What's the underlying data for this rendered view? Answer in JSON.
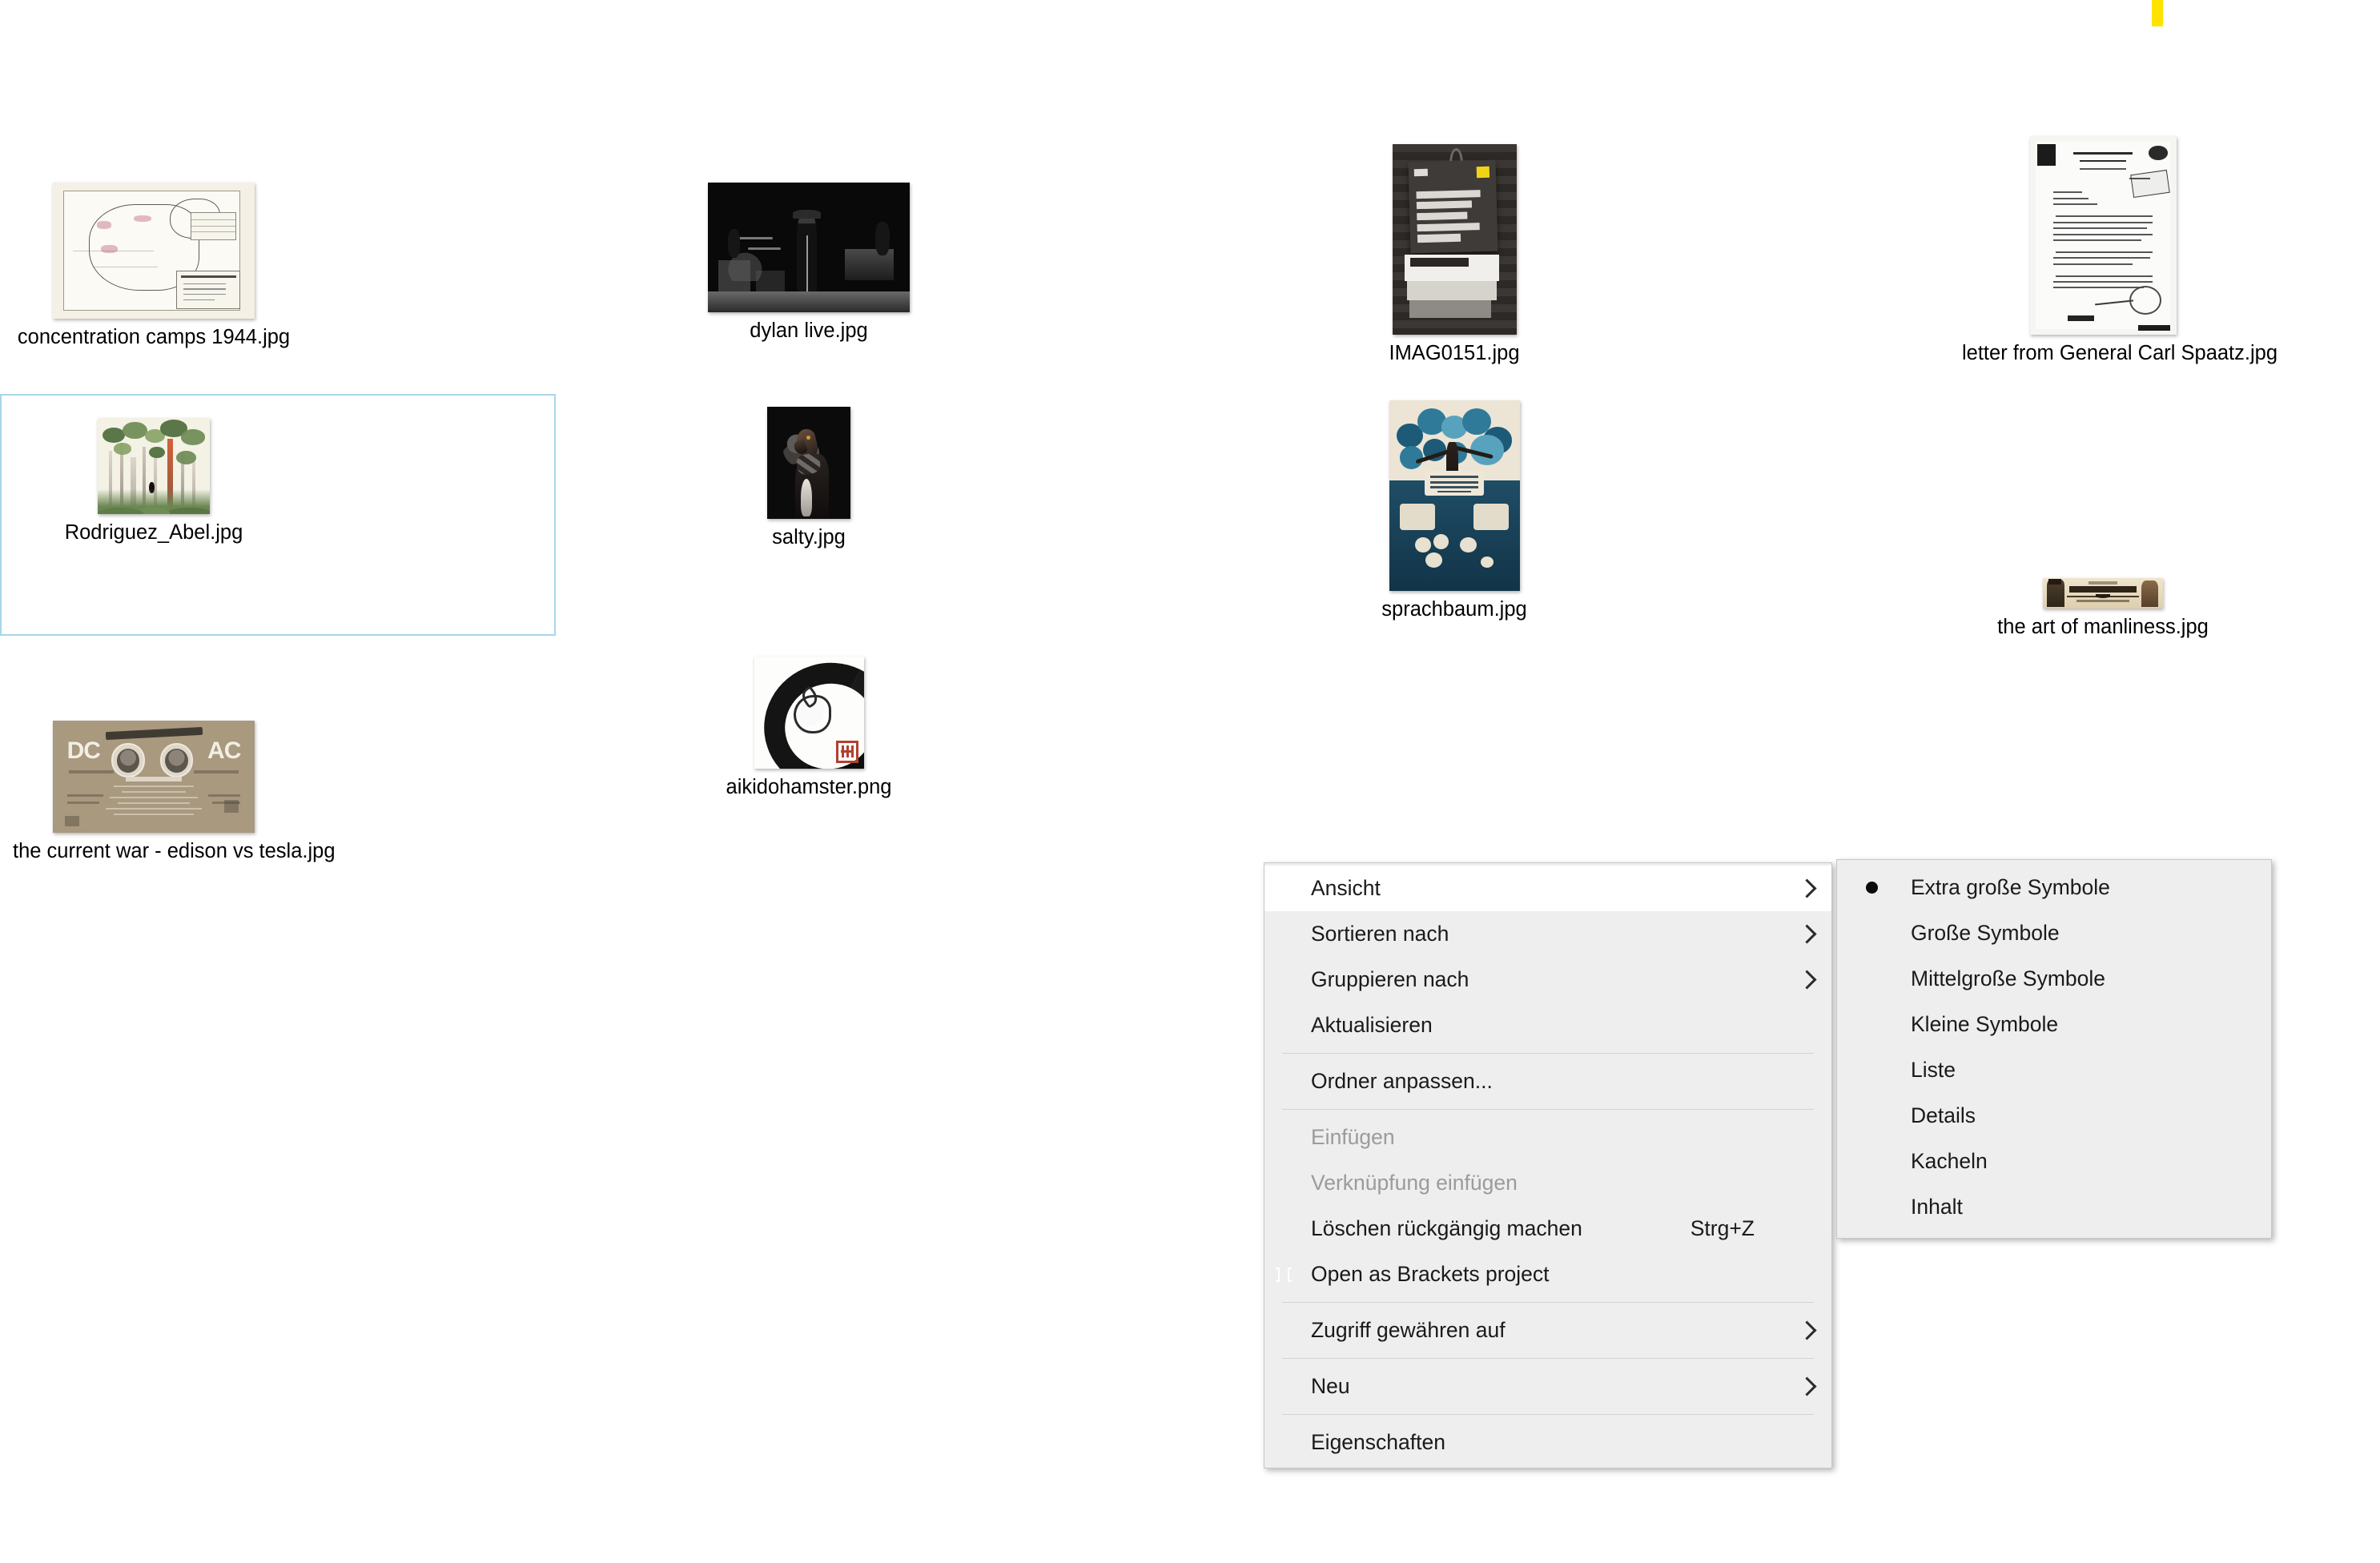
{
  "desktop": {
    "files": [
      {
        "name": "concentration camps 1944.jpg",
        "thumb": "map-thumbnail",
        "selected": false
      },
      {
        "name": "dylan live.jpg",
        "thumb": "concert-photo-thumbnail",
        "selected": false
      },
      {
        "name": "IMAG0151.jpg",
        "thumb": "clothing-hangtag-photo-thumbnail",
        "selected": false
      },
      {
        "name": "letter from General Carl Spaatz.jpg",
        "thumb": "scanned-letter-thumbnail",
        "selected": false
      },
      {
        "name": "Rodriguez_Abel.jpg",
        "thumb": "forest-painting-thumbnail",
        "selected": true
      },
      {
        "name": "salty.jpg",
        "thumb": "dog-portrait-thumbnail",
        "selected": false
      },
      {
        "name": "sprachbaum.jpg",
        "thumb": "language-tree-infographic-thumbnail",
        "selected": false
      },
      {
        "name": "the art of manliness.jpg",
        "thumb": "manliness-banner-thumbnail",
        "selected": false
      },
      {
        "name": "the current war - edison vs tesla.jpg",
        "thumb": "current-war-infographic-thumbnail",
        "selected": false
      },
      {
        "name": "aikidohamster.png",
        "thumb": "enso-hamster-thumbnail",
        "selected": false
      }
    ]
  },
  "context_menu": {
    "items": [
      {
        "label": "Ansicht",
        "submenu": true,
        "accel": "",
        "disabled": false,
        "hovered": true,
        "icon": ""
      },
      {
        "label": "Sortieren nach",
        "submenu": true,
        "accel": "",
        "disabled": false,
        "hovered": false,
        "icon": ""
      },
      {
        "label": "Gruppieren nach",
        "submenu": true,
        "accel": "",
        "disabled": false,
        "hovered": false,
        "icon": ""
      },
      {
        "label": "Aktualisieren",
        "submenu": false,
        "accel": "",
        "disabled": false,
        "hovered": false,
        "icon": ""
      },
      {
        "label": "Ordner anpassen...",
        "submenu": false,
        "accel": "",
        "disabled": false,
        "hovered": false,
        "icon": ""
      },
      {
        "label": "Einfügen",
        "submenu": false,
        "accel": "",
        "disabled": true,
        "hovered": false,
        "icon": ""
      },
      {
        "label": "Verknüpfung einfügen",
        "submenu": false,
        "accel": "",
        "disabled": true,
        "hovered": false,
        "icon": ""
      },
      {
        "label": "Löschen rückgängig machen",
        "submenu": false,
        "accel": "Strg+Z",
        "disabled": false,
        "hovered": false,
        "icon": ""
      },
      {
        "label": "Open as Brackets project",
        "submenu": false,
        "accel": "",
        "disabled": false,
        "hovered": false,
        "icon": "brackets-icon"
      },
      {
        "label": "Zugriff gewähren auf",
        "submenu": true,
        "accel": "",
        "disabled": false,
        "hovered": false,
        "icon": ""
      },
      {
        "label": "Neu",
        "submenu": true,
        "accel": "",
        "disabled": false,
        "hovered": false,
        "icon": ""
      },
      {
        "label": "Eigenschaften",
        "submenu": false,
        "accel": "",
        "disabled": false,
        "hovered": false,
        "icon": ""
      }
    ],
    "separators_after": [
      3,
      4,
      8,
      9,
      10
    ]
  },
  "view_submenu": {
    "items": [
      {
        "label": "Extra große Symbole",
        "checked": true
      },
      {
        "label": "Große Symbole",
        "checked": false
      },
      {
        "label": "Mittelgroße Symbole",
        "checked": false
      },
      {
        "label": "Kleine Symbole",
        "checked": false
      },
      {
        "label": "Liste",
        "checked": false
      },
      {
        "label": "Details",
        "checked": false
      },
      {
        "label": "Kacheln",
        "checked": false
      },
      {
        "label": "Inhalt",
        "checked": false
      }
    ]
  },
  "colors": {
    "menu_background": "#eeeeee",
    "menu_hover": "#ffffff",
    "selection_border": "#a9d5e8",
    "disabled_text": "#9b9b9b",
    "marker_yellow": "#ffe200",
    "brackets_blue": "#1a9bdc"
  }
}
